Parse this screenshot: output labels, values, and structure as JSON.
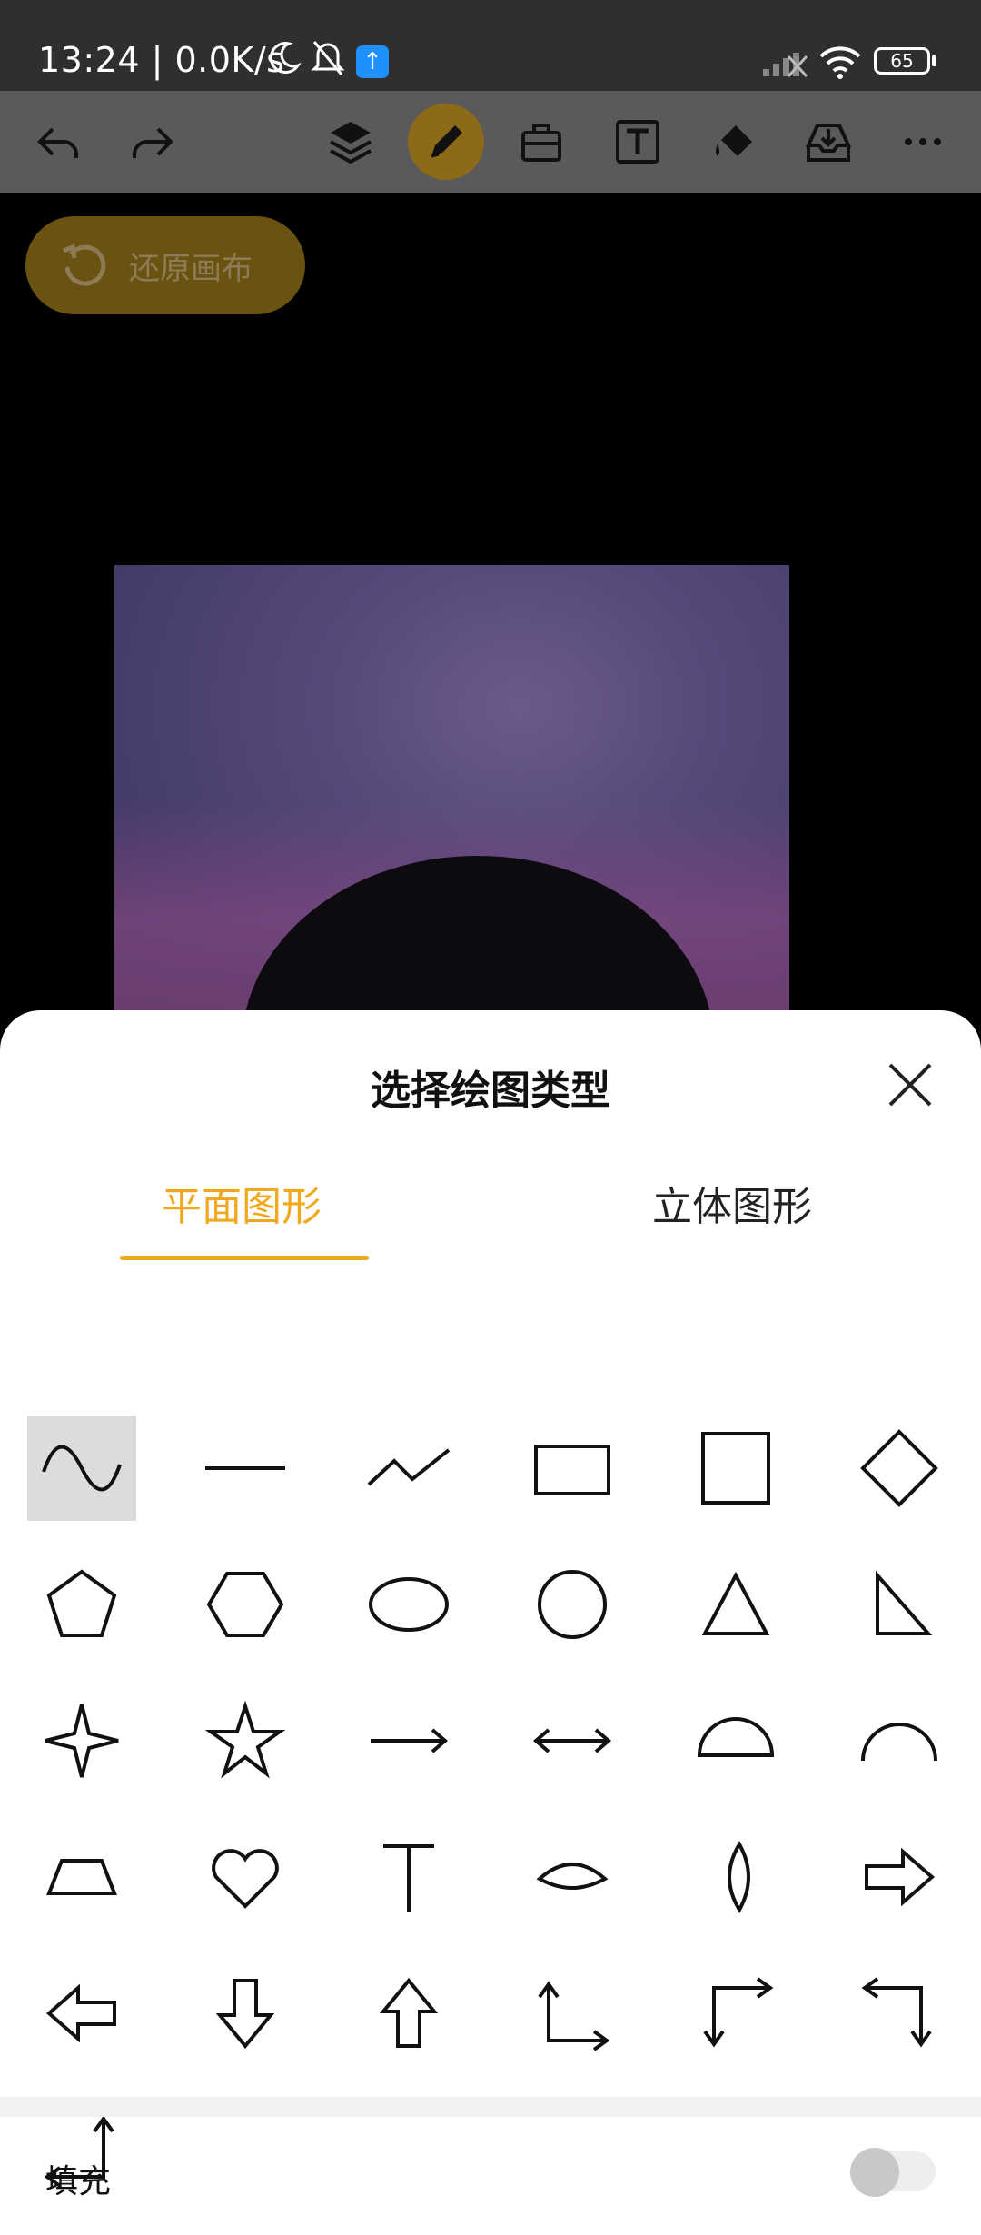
{
  "status_bar": {
    "time": "13:24 | 0.0K/s",
    "battery": "65"
  },
  "toolbar": {
    "items": [
      {
        "name": "undo-icon"
      },
      {
        "name": "redo-icon"
      },
      {
        "name": "layers-icon"
      },
      {
        "name": "pen-icon",
        "active": true
      },
      {
        "name": "toolbox-icon"
      },
      {
        "name": "text-icon"
      },
      {
        "name": "fill-bucket-icon"
      },
      {
        "name": "save-tray-icon"
      },
      {
        "name": "more-icon"
      }
    ],
    "accent": "#f2a81d"
  },
  "canvas": {
    "restore_label": "还原画布"
  },
  "sheet": {
    "title": "选择绘图类型",
    "tabs": [
      {
        "label": "平面图形",
        "selected": true
      },
      {
        "label": "立体图形",
        "selected": false
      }
    ],
    "shapes": [
      "wave",
      "line",
      "polyline",
      "rectangle",
      "square",
      "diamond",
      "pentagon",
      "hexagon",
      "ellipse",
      "circle",
      "triangle",
      "right-triangle",
      "four-point-star",
      "five-point-star",
      "arrow-right-line",
      "arrow-double-line",
      "half-disc",
      "arc",
      "trapezoid",
      "heart",
      "t-shape",
      "eye-lens",
      "rhombus-lens",
      "arrow-right-block",
      "arrow-left-block",
      "arrow-down-block",
      "arrow-up-block",
      "corner-up-right",
      "corner-right-down",
      "corner-left-down",
      "corner-right-up"
    ],
    "selected_shape": "wave",
    "fill_label": "填充",
    "fill_enabled": false
  }
}
